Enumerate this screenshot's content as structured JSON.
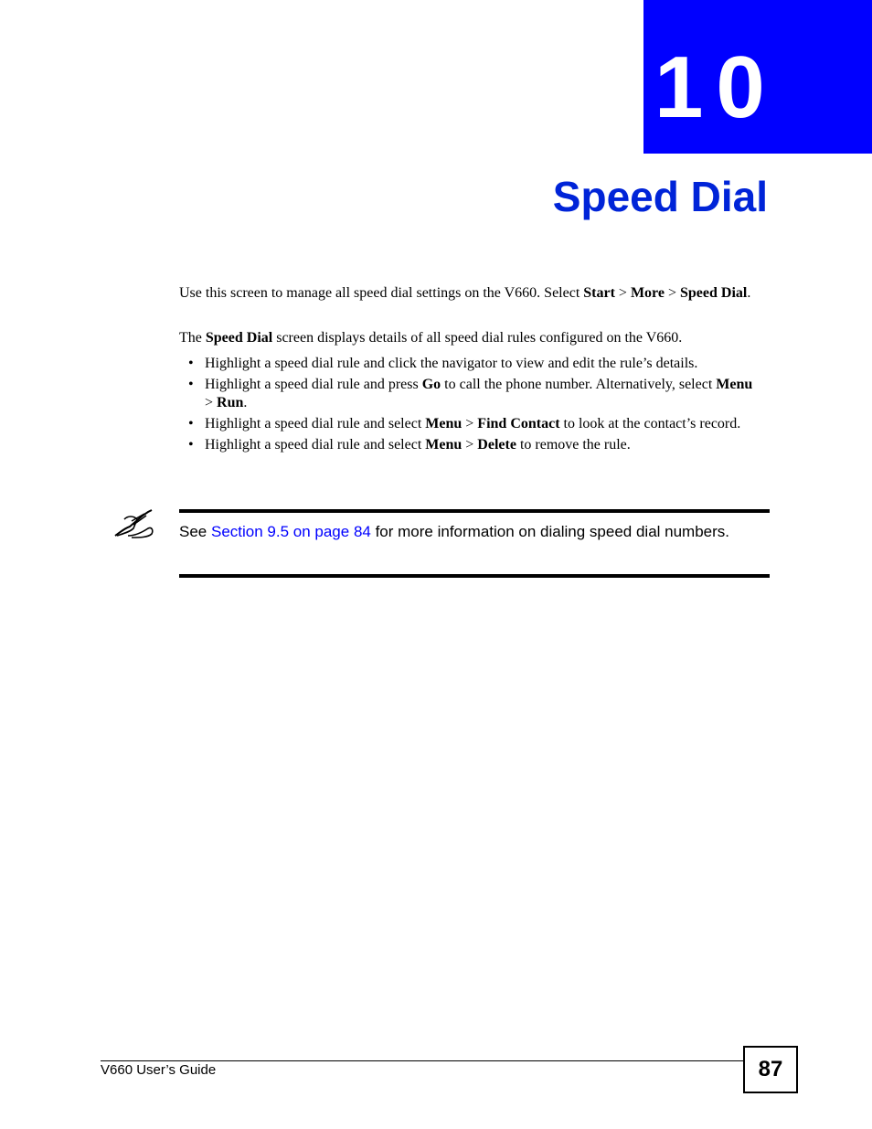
{
  "chapter": {
    "number": "10",
    "title": "Speed Dial",
    "accent_color": "#0000ff"
  },
  "intro": {
    "p1": [
      {
        "t": "Use this screen to manage all speed dial settings on the V660. Select ",
        "b": false
      },
      {
        "t": "Start",
        "b": true
      },
      {
        "t": " > ",
        "b": false
      },
      {
        "t": "More",
        "b": true
      },
      {
        "t": " > ",
        "b": false
      },
      {
        "t": "Speed Dial",
        "b": true
      },
      {
        "t": ".",
        "b": false
      }
    ],
    "p2": [
      {
        "t": "The ",
        "b": false
      },
      {
        "t": "Speed Dial",
        "b": true
      },
      {
        "t": " screen displays details of all speed dial rules configured on the V660.",
        "b": false
      }
    ]
  },
  "bullets": [
    [
      {
        "t": "Highlight a speed dial rule and click the navigator to view and edit the rule’s details.",
        "b": false
      }
    ],
    [
      {
        "t": "Highlight a speed dial rule and press ",
        "b": false
      },
      {
        "t": "Go",
        "b": true
      },
      {
        "t": " to call the phone number. Alternatively, select ",
        "b": false
      },
      {
        "t": "Menu",
        "b": true
      },
      {
        "t": " > ",
        "b": false
      },
      {
        "t": "Run",
        "b": true
      },
      {
        "t": ".",
        "b": false
      }
    ],
    [
      {
        "t": "Highlight a speed dial rule and select ",
        "b": false
      },
      {
        "t": "Menu",
        "b": true
      },
      {
        "t": " > ",
        "b": false
      },
      {
        "t": "Find Contact",
        "b": true
      },
      {
        "t": " to look at the contact’s record.",
        "b": false
      }
    ],
    [
      {
        "t": "Highlight a speed dial rule and select ",
        "b": false
      },
      {
        "t": "Menu",
        "b": true
      },
      {
        "t": " > ",
        "b": false
      },
      {
        "t": "Delete",
        "b": true
      },
      {
        "t": " to remove the rule.",
        "b": false
      }
    ]
  ],
  "note": {
    "icon": "note-pencil-icon",
    "prefix": "See ",
    "link_text": "Section 9.5 on page 84",
    "suffix": " for more information on dialing speed dial numbers."
  },
  "footer": {
    "guide_title": "V660 User’s Guide",
    "page_number": "87"
  }
}
